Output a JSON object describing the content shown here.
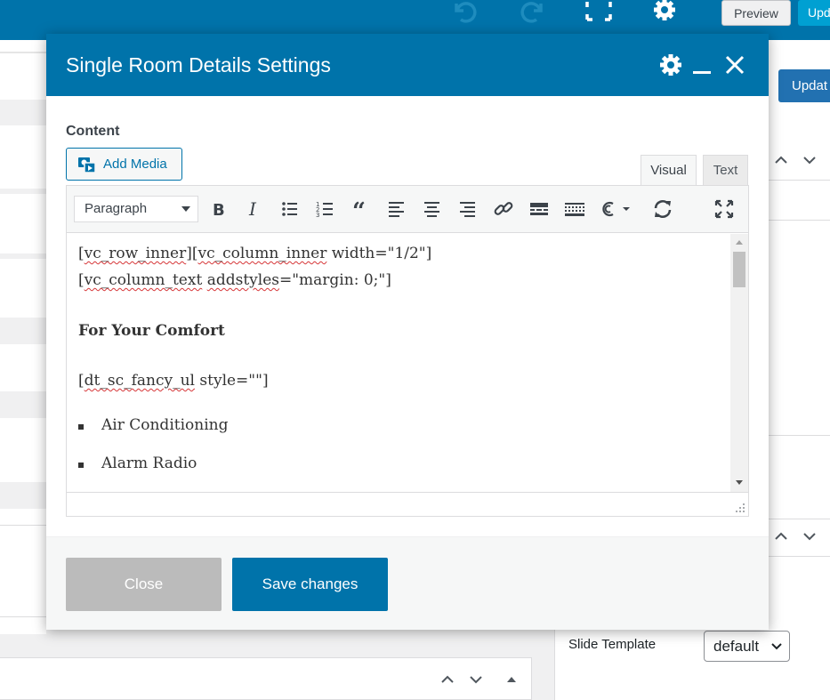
{
  "topbar": {
    "preview_label": "Preview",
    "update_label": "Upd",
    "icons": [
      "undo-icon",
      "redo-icon",
      "fullscreen-icon",
      "gear-icon"
    ]
  },
  "background": {
    "update_label": "Updat",
    "slide_template_label": "Slide Template",
    "slide_template_value": "default"
  },
  "modal": {
    "title": "Single Room Details Settings",
    "header_icons": [
      "gear-icon",
      "minimize-icon",
      "close-icon"
    ],
    "content_label": "Content",
    "add_media_label": "Add Media",
    "tabs": [
      {
        "label": "Visual",
        "active": true
      },
      {
        "label": "Text",
        "active": false
      }
    ],
    "toolbar": {
      "format_select": "Paragraph",
      "buttons": [
        "bold",
        "italic",
        "bullet-list",
        "numbered-list",
        "blockquote",
        "align-left",
        "align-center",
        "align-right",
        "link",
        "read-more",
        "toolbar-toggle",
        "shortcode",
        "refresh",
        "fullscreen"
      ]
    },
    "editor": {
      "line1a": "vc_row_inner",
      "line1b": "vc_column_inner",
      "line1c": " width=\"1/2\"]",
      "line2a": "vc_column_text",
      "line2b": "addstyles",
      "line2c": "=\"margin: 0;\"]",
      "heading": "For Your Comfort",
      "line3a": "dt_sc_fancy_ul",
      "line3b": " style=\"\"]",
      "list_items": [
        "Air Conditioning",
        "Alarm Radio"
      ]
    },
    "close_label": "Close",
    "save_label": "Save changes"
  },
  "colors": {
    "header_blue": "#0073aa",
    "close_gray": "#bbbbbb",
    "link_blue": "#0073aa"
  }
}
